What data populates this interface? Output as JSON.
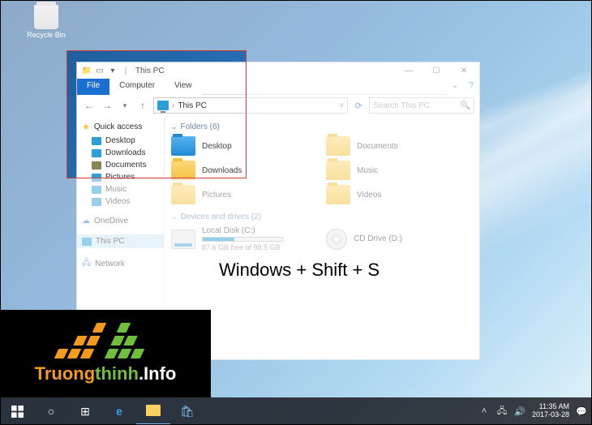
{
  "desktop": {
    "recycle_bin_label": "Recycle Bin"
  },
  "explorer": {
    "title": "This PC",
    "tabs": {
      "file": "File",
      "computer": "Computer",
      "view": "View"
    },
    "address": "This PC",
    "search_placeholder": "Search This PC",
    "sidebar": {
      "quick_access": "Quick access",
      "items": [
        "Desktop",
        "Downloads",
        "Documents",
        "Pictures",
        "Music",
        "Videos"
      ],
      "onedrive": "OneDrive",
      "thispc": "This PC",
      "network": "Network"
    },
    "sections": {
      "folders_label": "Folders (6)",
      "folders": [
        "Desktop",
        "Documents",
        "Downloads",
        "Music",
        "Pictures",
        "Videos"
      ],
      "drives_label": "Devices and drives (2)",
      "drive_c": {
        "name": "Local Disk (C:)",
        "sub": "87.6 GB free of 99.5 GB"
      },
      "cd": {
        "name": "CD Drive (D:)"
      }
    }
  },
  "overlay": {
    "shortcut_text": "Windows + Shift + S"
  },
  "taskbar": {
    "time": "11:35 AM",
    "date": "2017-03-28"
  },
  "logo": {
    "text_plain": "Truongthinh.Info"
  }
}
